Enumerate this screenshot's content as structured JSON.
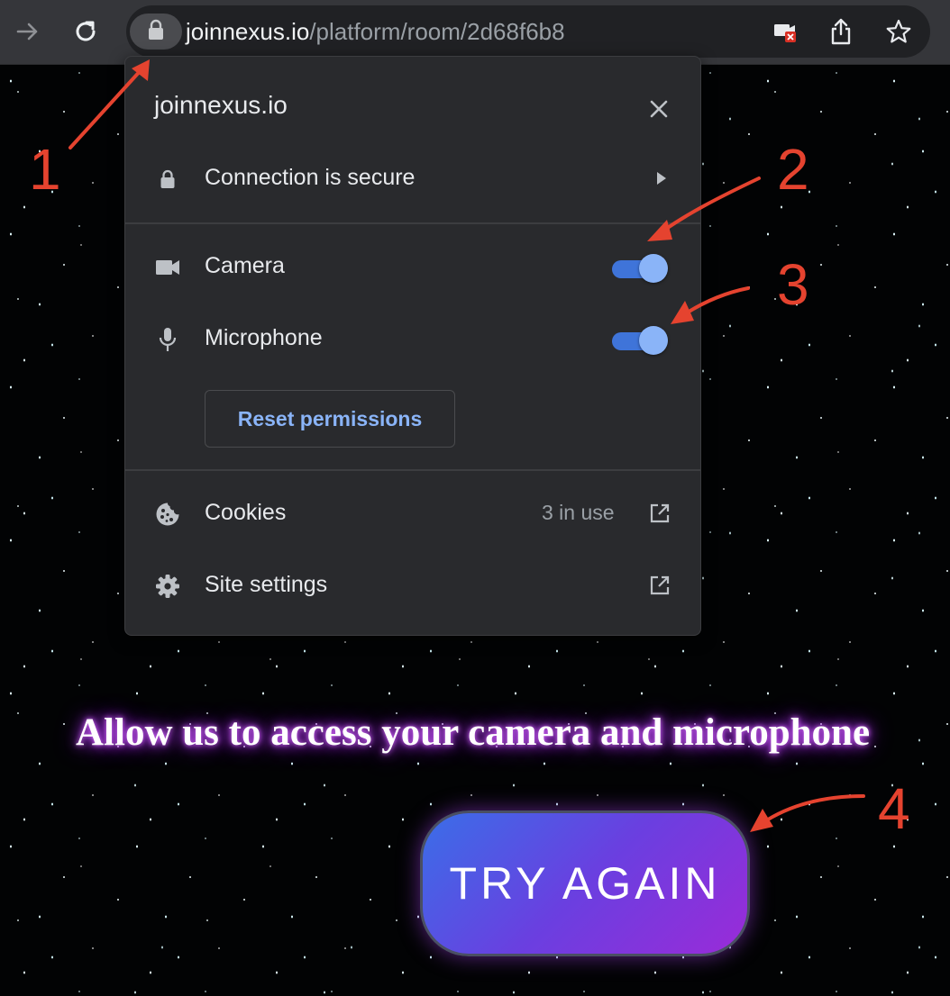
{
  "browser": {
    "url_host": "joinnexus.io",
    "url_path": "/platform/room/2d68f6b8",
    "icons": {
      "forward": "forward-arrow-icon",
      "reload": "reload-icon",
      "lock": "lock-icon",
      "camera_blocked": "camera-blocked-icon",
      "share": "share-icon",
      "bookmark": "star-icon"
    }
  },
  "popup": {
    "site": "joinnexus.io",
    "connection": {
      "label": "Connection is secure",
      "icon": "lock-icon"
    },
    "permissions": [
      {
        "label": "Camera",
        "icon": "video-camera-icon",
        "enabled": true
      },
      {
        "label": "Microphone",
        "icon": "microphone-icon",
        "enabled": true
      }
    ],
    "reset_label": "Reset permissions",
    "cookies": {
      "label": "Cookies",
      "count": "3 in use",
      "icon": "cookie-icon"
    },
    "site_settings": {
      "label": "Site settings",
      "icon": "gear-icon"
    }
  },
  "page": {
    "headline": "Allow us to access your camera and microphone",
    "try_again": "TRY AGAIN"
  },
  "annotations": [
    "1",
    "2",
    "3",
    "4"
  ],
  "colors": {
    "toolbar": "#35363a",
    "popup_bg": "#292a2d",
    "accent": "#8ab4f8",
    "toggle_track": "#3f74d9",
    "annotation": "#e5432f",
    "glow": "#b83cff"
  }
}
